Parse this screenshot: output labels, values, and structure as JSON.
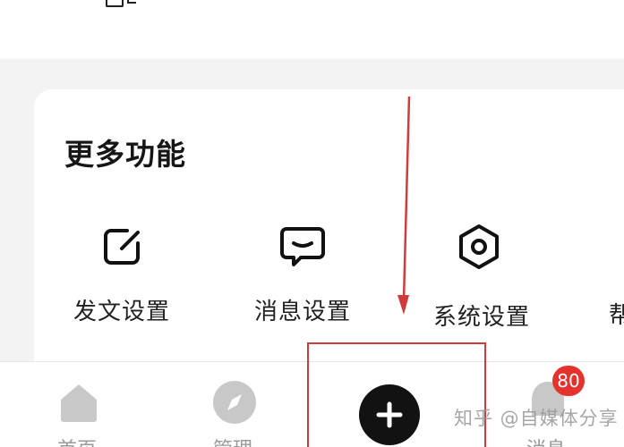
{
  "more_features": {
    "title": "更多功能",
    "items": [
      {
        "label": "发文设置",
        "icon": "edit-square-icon"
      },
      {
        "label": "消息设置",
        "icon": "message-bubble-icon"
      },
      {
        "label": "系统设置",
        "icon": "hexagon-gear-icon"
      },
      {
        "label": "帮",
        "icon": ""
      }
    ]
  },
  "bottom_nav": {
    "items": [
      {
        "label": "首页",
        "icon": "home-icon"
      },
      {
        "label": "管理",
        "icon": "compass-icon"
      },
      {
        "label": "",
        "icon": "plus-icon"
      },
      {
        "label": "消息",
        "icon": "bell-icon"
      }
    ],
    "message_badge": "80"
  },
  "watermark": "知乎 @自媒体分享",
  "colors": {
    "annotation": "#d23b3b",
    "badge": "#e5322d",
    "nav_inactive": "#c8c8c8",
    "plus_button": "#121212"
  }
}
